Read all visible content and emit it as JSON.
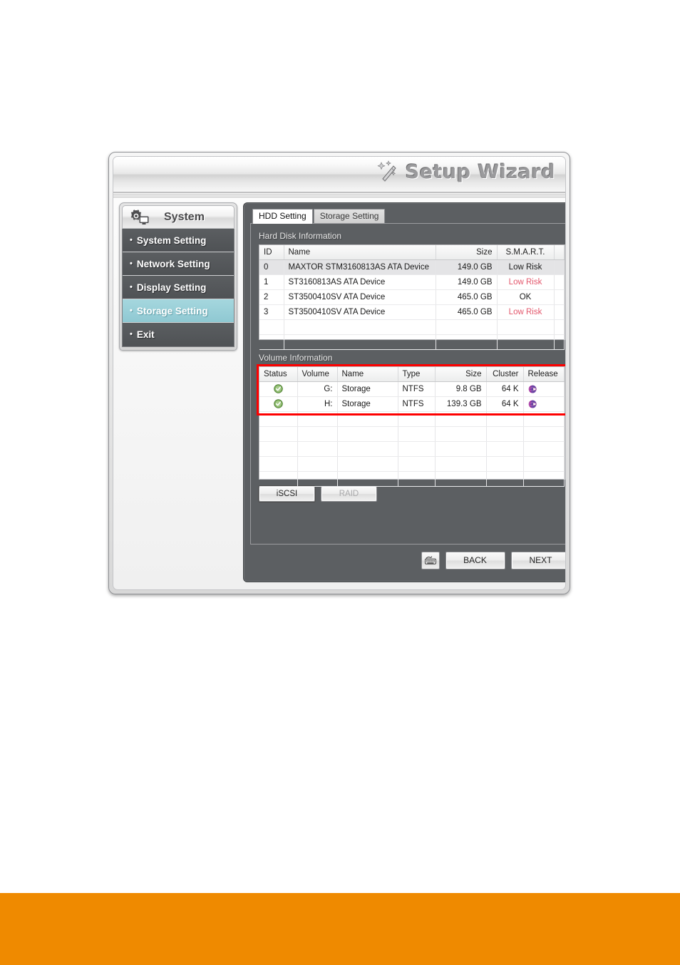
{
  "window": {
    "title": "Setup Wizard",
    "wand_icon": "magic-wand-icon"
  },
  "sidebar": {
    "header": {
      "label": "System",
      "icon": "gear-monitor-icon"
    },
    "items": [
      {
        "label": "System Setting",
        "active": false
      },
      {
        "label": "Network Setting",
        "active": false
      },
      {
        "label": "Display Setting",
        "active": false
      },
      {
        "label": "Storage Setting",
        "active": true
      },
      {
        "label": "Exit",
        "active": false
      }
    ],
    "bullet": "•"
  },
  "main": {
    "tabs": [
      {
        "label": "HDD Setting",
        "active": true
      },
      {
        "label": "Storage Setting",
        "active": false
      }
    ],
    "hdd_section": {
      "label": "Hard Disk Information",
      "columns": [
        "ID",
        "Name",
        "Size",
        "S.M.A.R.T."
      ],
      "rows": [
        {
          "id": "0",
          "name": "MAXTOR STM3160813AS ATA Device",
          "size": "149.0 GB",
          "smart": "Low Risk",
          "smart_red": false,
          "selected": true
        },
        {
          "id": "1",
          "name": "ST3160813AS ATA Device",
          "size": "149.0 GB",
          "smart": "Low Risk",
          "smart_red": true,
          "selected": false
        },
        {
          "id": "2",
          "name": "ST3500410SV ATA Device",
          "size": "465.0 GB",
          "smart": "OK",
          "smart_red": false,
          "selected": false
        },
        {
          "id": "3",
          "name": "ST3500410SV ATA Device",
          "size": "465.0 GB",
          "smart": "Low Risk",
          "smart_red": true,
          "selected": false
        }
      ],
      "empty_rows": 2
    },
    "volume_section": {
      "label": "Volume Information",
      "columns": [
        "Status",
        "Volume",
        "Name",
        "Type",
        "Size",
        "Cluster",
        "Release"
      ],
      "rows": [
        {
          "status_icon": "green-check-icon",
          "volume": "G:",
          "name": "Storage",
          "type": "NTFS",
          "size": "9.8 GB",
          "cluster": "64 K",
          "release_icon": "globe-release-icon"
        },
        {
          "status_icon": "green-check-icon",
          "volume": "H:",
          "name": "Storage",
          "type": "NTFS",
          "size": "139.3 GB",
          "cluster": "64 K",
          "release_icon": "globe-release-icon"
        }
      ],
      "empty_rows": 5,
      "highlight_color": "#fe0000"
    },
    "action_buttons": [
      {
        "label": "iSCSI",
        "disabled": false,
        "focused": true
      },
      {
        "label": "RAID",
        "disabled": true,
        "focused": false
      }
    ]
  },
  "footer": {
    "keyboard_button": {
      "icon": "keyboard-icon"
    },
    "back_label": "BACK",
    "next_label": "NEXT"
  },
  "colors": {
    "accent_active": "#8fc8d2",
    "panel_dark": "#5c5f62",
    "highlight_red": "#fe0000",
    "risk_red": "#e3566b",
    "orange_band": "#ef8a00",
    "status_green": "#5c9c3f",
    "release_purple": "#a0329b"
  }
}
